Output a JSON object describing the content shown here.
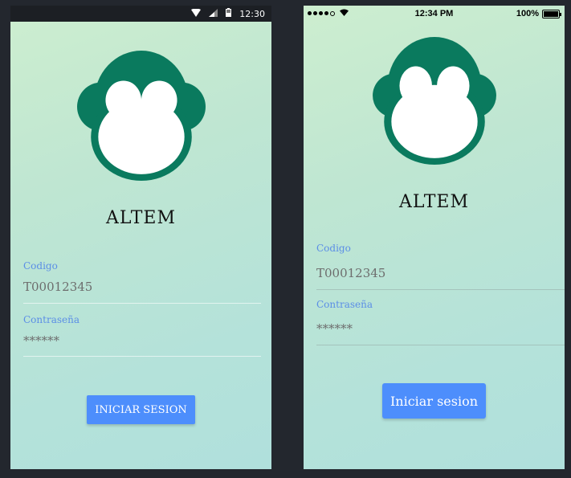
{
  "android": {
    "status_time": "12:30",
    "app_title": "ALTEM",
    "code_label": "Codigo",
    "code_value": "T00012345",
    "password_label": "Contraseña",
    "password_value": "******",
    "login_button": "INICIAR SESION"
  },
  "ios": {
    "status_time": "12:34 PM",
    "battery_text": "100%",
    "app_title": "ALTEM",
    "code_label": "Codigo",
    "code_value": "T00012345",
    "password_label": "Contraseña",
    "password_value": "******",
    "login_button": "Iniciar sesion"
  },
  "colors": {
    "logo_green": "#0a7a5e",
    "button_blue": "#4d8efc",
    "label_blue": "#5b8ee6",
    "background": "#23272e"
  },
  "icons": [
    "wifi-icon",
    "signal-icon",
    "battery-icon",
    "monkey-logo-icon"
  ]
}
